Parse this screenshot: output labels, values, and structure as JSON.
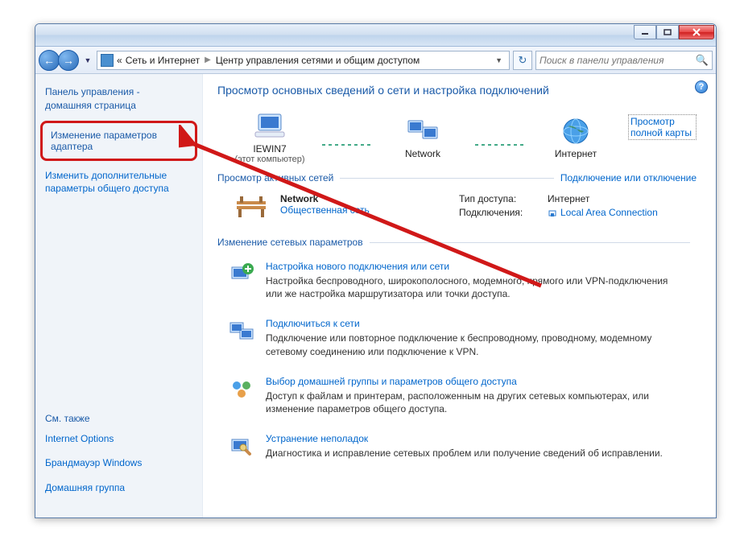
{
  "breadcrumb": {
    "sep_prefix": "«",
    "part1": "Сеть и Интернет",
    "part2": "Центр управления сетями и общим доступом"
  },
  "search": {
    "placeholder": "Поиск в панели управления"
  },
  "sidebar": {
    "cp_home_l1": "Панель управления -",
    "cp_home_l2": "домашняя страница",
    "adapter_l1": "Изменение параметров",
    "adapter_l2": "адаптера",
    "advshare_l1": "Изменить дополнительные",
    "advshare_l2": "параметры общего доступа",
    "see_also": "См. также",
    "internet_options": "Internet Options",
    "firewall": "Брандмауэр Windows",
    "homegroup": "Домашняя группа"
  },
  "main": {
    "heading": "Просмотр основных сведений о сети и настройка подключений",
    "full_map": "Просмотр полной карты",
    "node_this_pc": "IEWIN7",
    "node_this_pc_sub": "(этот компьютер)",
    "node_network": "Network",
    "node_internet": "Интернет",
    "active_nets_header": "Просмотр активных сетей",
    "connect_disconnect": "Подключение или отключение",
    "network_name": "Network",
    "network_type": "Общественная сеть",
    "access_type_label": "Тип доступа:",
    "access_type_value": "Интернет",
    "connections_label": "Подключения:",
    "connection_name": "Local Area Connection",
    "change_settings_header": "Изменение сетевых параметров",
    "items": [
      {
        "title": "Настройка нового подключения или сети",
        "desc": "Настройка беспроводного, широкополосного, модемного, прямого или VPN-подключения или же настройка маршрутизатора или точки доступа."
      },
      {
        "title": "Подключиться к сети",
        "desc": "Подключение или повторное подключение к беспроводному, проводному, модемному сетевому соединению или подключение к VPN."
      },
      {
        "title": "Выбор домашней группы и параметров общего доступа",
        "desc": "Доступ к файлам и принтерам, расположенным на других сетевых компьютерах, или изменение параметров общего доступа."
      },
      {
        "title": "Устранение неполадок",
        "desc": "Диагностика и исправление сетевых проблем или получение сведений об исправлении."
      }
    ]
  }
}
